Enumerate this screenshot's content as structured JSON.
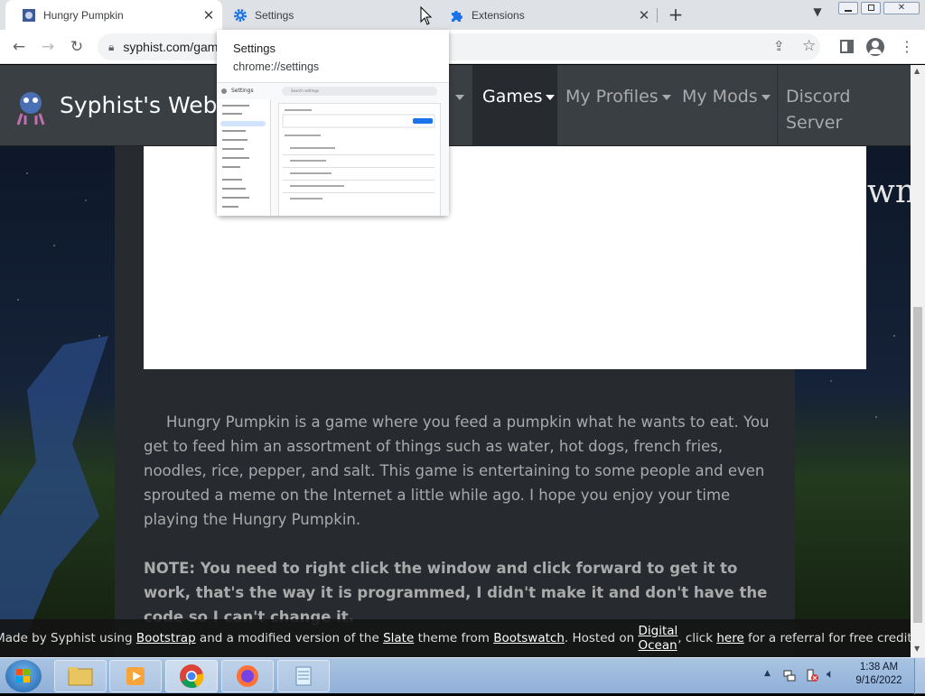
{
  "tabs": [
    {
      "title": "Hungry Pumpkin",
      "active": true
    },
    {
      "title": "Settings",
      "active": false
    },
    {
      "title": "Extensions",
      "active": false
    }
  ],
  "new_tab_label": "+",
  "omnibox": {
    "url": "syphist.com/gam"
  },
  "hover_card": {
    "title": "Settings",
    "url": "chrome://settings",
    "thumb_title": "Settings",
    "thumb_search": "Search settings"
  },
  "site": {
    "brand": "Syphist's Websi",
    "nav": [
      {
        "label": "Games",
        "active": true
      },
      {
        "label": "My Profiles",
        "active": false
      },
      {
        "label": "My Mods",
        "active": false
      }
    ],
    "discord_line1": "Discord",
    "discord_line2": "Server"
  },
  "article": {
    "paragraph": "Hungry Pumpkin is a game where you feed a pumpkin what he wants to eat. You get to feed him an assortment of things such as water, hot dogs, french fries, noodles, rice, pepper, and salt. This game is entertaining to some people and even sprouted a meme on the Internet a little while ago. I hope you enjoy your time playing the Hungry Pumpkin.",
    "note": "NOTE: You need to right click the window and click forward to get it to work, that's the way it is programmed, I didn't make it and don't have the code so I can't change it."
  },
  "footer": {
    "t1": "Made by Syphist using ",
    "l1": "Bootstrap",
    "t2": " and a modified version of the ",
    "l2": "Slate",
    "t3": " theme from ",
    "l3": "Bootswatch",
    "t4": ". Hosted on ",
    "l4": "Digital Ocean",
    "t5": ", click ",
    "l5": "here",
    "t6": " for a referral for free credit."
  },
  "taskbar": {
    "time": "1:38 AM",
    "date": "9/16/2022"
  },
  "colors": {
    "navbar": "#3a3f44",
    "content": "#272b30",
    "tabbar": "#dee1e6",
    "taskbar": "#8fb0d8"
  }
}
